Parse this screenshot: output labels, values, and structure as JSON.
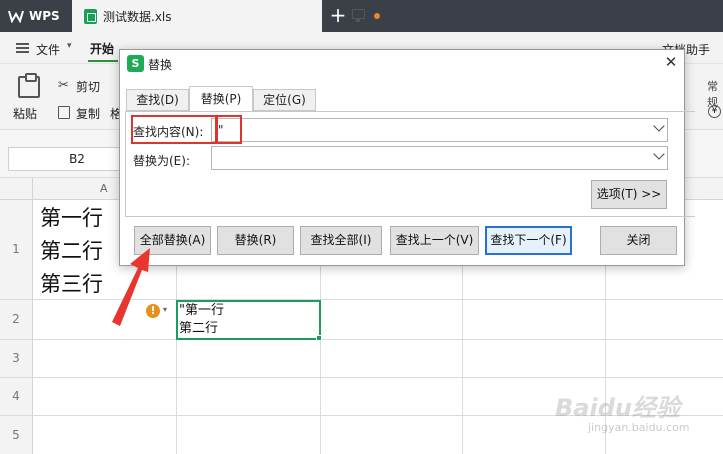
{
  "titlebar": {
    "app_label": "WPS",
    "doc_title": "测试数据.xls"
  },
  "menu": {
    "file": "文件",
    "start": "开始",
    "right_fragment": "文档助手"
  },
  "ribbon": {
    "paste": "粘贴",
    "cut": "剪切",
    "copy": "复制",
    "format_fragment": "格",
    "right_fragment": "常规"
  },
  "formula": {
    "namebox": "B2"
  },
  "grid": {
    "col_a": "A",
    "rows": [
      "1",
      "2",
      "3",
      "4",
      "5"
    ],
    "a1_lines": [
      "第一行",
      "第二行",
      "第三行"
    ],
    "b2_lines": [
      "\"第一行",
      "第二行"
    ]
  },
  "dialog": {
    "title": "替换",
    "close_glyph": "✕",
    "tabs": [
      {
        "label": "查找(D)"
      },
      {
        "label": "替换(P)"
      },
      {
        "label": "定位(G)"
      }
    ],
    "find_label": "查找内容(N):",
    "find_value": "\"",
    "replace_label": "替换为(E):",
    "replace_value": "",
    "options_button": "选项(T) >>",
    "buttons": {
      "replace_all": "全部替换(A)",
      "replace": "替换(R)",
      "find_all": "查找全部(I)",
      "find_prev": "查找上一个(V)",
      "find_next": "查找下一个(F)",
      "close": "关闭"
    }
  },
  "watermark": {
    "main": "Baidu经验",
    "sub": "jingyan.baidu.com"
  },
  "colors": {
    "accent_green": "#1b9e5a",
    "annotation_red": "#e0322e",
    "titlebar": "#3b3f47"
  }
}
